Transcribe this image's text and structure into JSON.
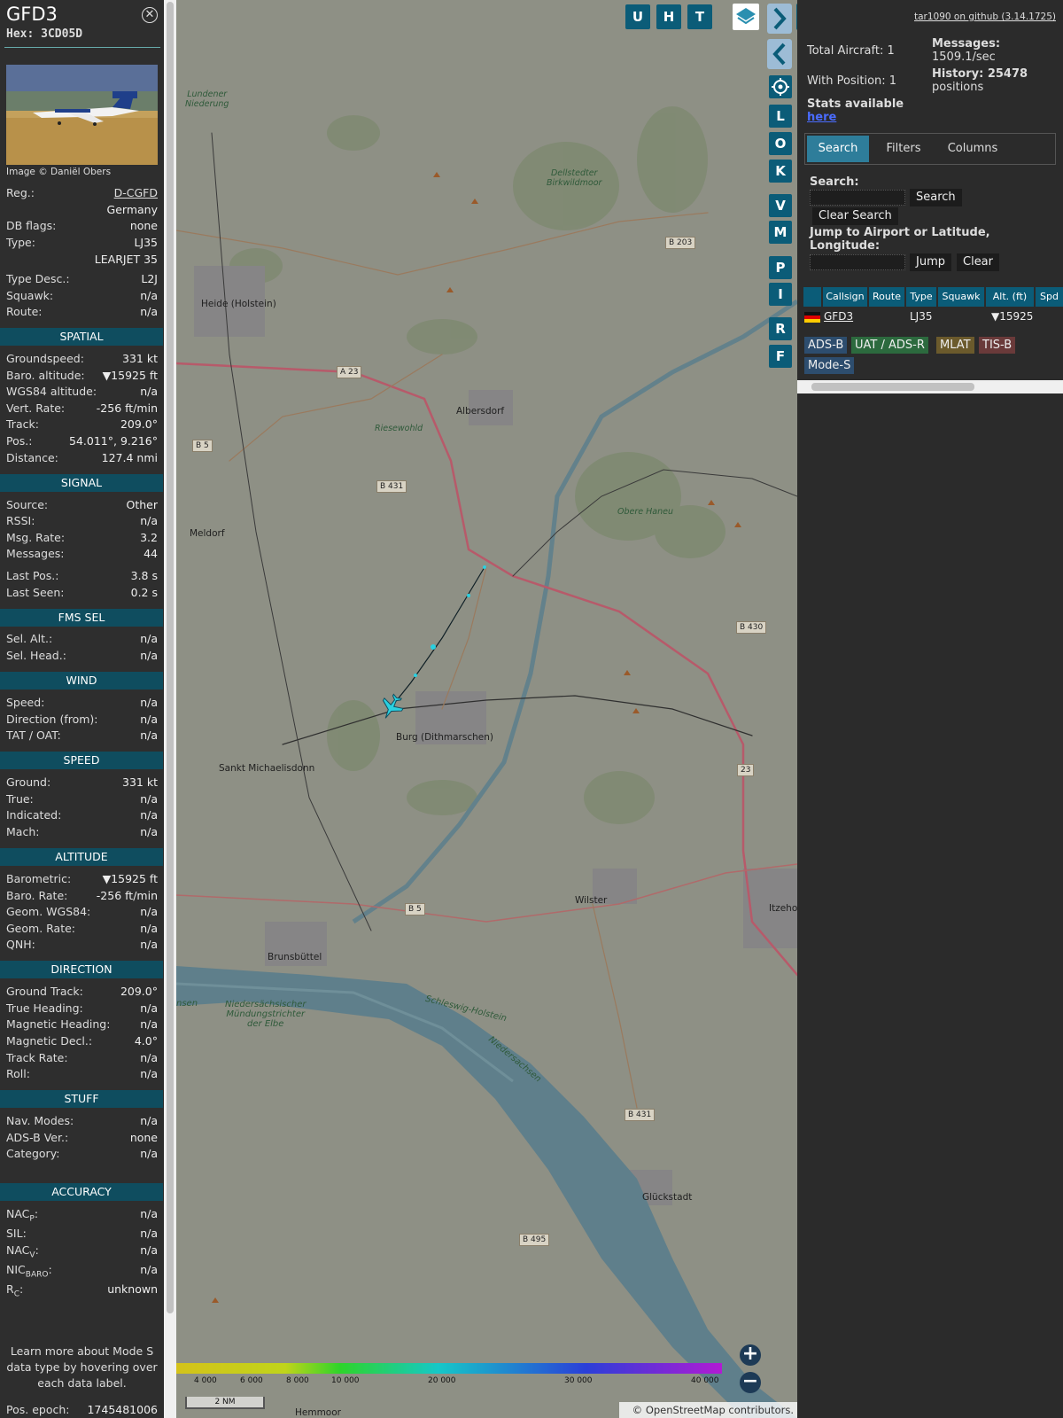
{
  "aircraft": {
    "callsign": "GFD3",
    "hex_label": "Hex: 3CD05D",
    "image_credit": "Image © Daniël Obers",
    "info": [
      {
        "label": "Reg.:",
        "value": "D-CGFD"
      },
      {
        "label": "",
        "value": "Germany"
      },
      {
        "label": "DB flags:",
        "value": "none"
      },
      {
        "label": "Type:",
        "value": "LJ35"
      },
      {
        "label": "",
        "value": "LEARJET 35"
      },
      {
        "label": "Type Desc.:",
        "value": "L2J"
      },
      {
        "label": "Squawk:",
        "value": "n/a"
      },
      {
        "label": "Route:",
        "value": "n/a"
      }
    ]
  },
  "sections": {
    "spatial": {
      "title": "SPATIAL",
      "rows": [
        {
          "label": "Groundspeed:",
          "value": "331 kt"
        },
        {
          "label": "Baro. altitude:",
          "value": "▼15925 ft"
        },
        {
          "label": "WGS84 altitude:",
          "value": "n/a"
        },
        {
          "label": "Vert. Rate:",
          "value": "-256 ft/min"
        },
        {
          "label": "Track:",
          "value": "209.0°"
        },
        {
          "label": "Pos.:",
          "value": "54.011°, 9.216°"
        },
        {
          "label": "Distance:",
          "value": "127.4 nmi"
        }
      ]
    },
    "signal": {
      "title": "SIGNAL",
      "rows": [
        {
          "label": "Source:",
          "value": "Other"
        },
        {
          "label": "RSSI:",
          "value": "n/a"
        },
        {
          "label": "Msg. Rate:",
          "value": "3.2"
        },
        {
          "label": "Messages:",
          "value": "44"
        },
        {
          "label": "Last Pos.:",
          "value": "3.8 s"
        },
        {
          "label": "Last Seen:",
          "value": "0.2 s"
        }
      ]
    },
    "fms": {
      "title": "FMS SEL",
      "rows": [
        {
          "label": "Sel. Alt.:",
          "value": "n/a"
        },
        {
          "label": "Sel. Head.:",
          "value": "n/a"
        }
      ]
    },
    "wind": {
      "title": "WIND",
      "rows": [
        {
          "label": "Speed:",
          "value": "n/a"
        },
        {
          "label": "Direction (from):",
          "value": "n/a"
        },
        {
          "label": "TAT / OAT:",
          "value": "n/a"
        }
      ]
    },
    "speed": {
      "title": "SPEED",
      "rows": [
        {
          "label": "Ground:",
          "value": "331 kt"
        },
        {
          "label": "True:",
          "value": "n/a"
        },
        {
          "label": "Indicated:",
          "value": "n/a"
        },
        {
          "label": "Mach:",
          "value": "n/a"
        }
      ]
    },
    "altitude": {
      "title": "ALTITUDE",
      "rows": [
        {
          "label": "Barometric:",
          "value": "▼15925 ft"
        },
        {
          "label": "Baro. Rate:",
          "value": "-256 ft/min"
        },
        {
          "label": "Geom. WGS84:",
          "value": "n/a"
        },
        {
          "label": "Geom. Rate:",
          "value": "n/a"
        },
        {
          "label": "QNH:",
          "value": "n/a"
        }
      ]
    },
    "direction": {
      "title": "DIRECTION",
      "rows": [
        {
          "label": "Ground Track:",
          "value": "209.0°"
        },
        {
          "label": "True Heading:",
          "value": "n/a"
        },
        {
          "label": "Magnetic Heading:",
          "value": "n/a"
        },
        {
          "label": "Magnetic Decl.:",
          "value": "4.0°"
        },
        {
          "label": "Track Rate:",
          "value": "n/a"
        },
        {
          "label": "Roll:",
          "value": "n/a"
        }
      ]
    },
    "stuff": {
      "title": "STUFF",
      "rows": [
        {
          "label": "Nav. Modes:",
          "value": "n/a"
        },
        {
          "label": "ADS-B Ver.:",
          "value": "none"
        },
        {
          "label": "Category:",
          "value": "n/a"
        }
      ]
    },
    "accuracy": {
      "title": "ACCURACY",
      "rows": [
        {
          "label": "NAC",
          "sub": "P",
          "suffix": ":",
          "value": "n/a"
        },
        {
          "label": "SIL:",
          "sub": "",
          "suffix": "",
          "value": "n/a"
        },
        {
          "label": "NAC",
          "sub": "V",
          "suffix": ":",
          "value": "n/a"
        },
        {
          "label": "NIC",
          "sub": "BARO",
          "suffix": ":",
          "value": "n/a"
        },
        {
          "label": "R",
          "sub": "C",
          "suffix": ":",
          "value": "unknown"
        }
      ]
    }
  },
  "learn_more": "Learn more about Mode S data type by hovering over each data label.",
  "pos_epoch": {
    "label": "Pos. epoch:",
    "value": "1745481006"
  },
  "map": {
    "top_buttons": [
      "U",
      "H",
      "T"
    ],
    "side_buttons": [
      "L",
      "O",
      "K",
      "V",
      "M",
      "P",
      "I",
      "R",
      "F"
    ],
    "places": [
      "Heide (Holstein)",
      "Albersdorf",
      "Meldorf",
      "Burg (Dithmarschen)",
      "Sankt Michaelisdonn",
      "Wilster",
      "Brunsbüttel",
      "Glückstadt",
      "Itzeho",
      "Hemmoor"
    ],
    "nature": [
      "Lundener\nNiederung",
      "Dellstedter\nBirkwildmoor",
      "Riesewohld",
      "Obere Haneu",
      "Niedersächsischer\nMündungstrichter\nder Elbe",
      "Schleswig-Holstein",
      "Niedersachsen",
      "nsen"
    ],
    "roads": [
      "B 203",
      "A 23",
      "B 5",
      "B 431",
      "B 430",
      "B 5",
      "23",
      "B 431",
      "B 495"
    ],
    "legend_ticks": [
      "4 000",
      "6 000",
      "8 000",
      "10 000",
      "20 000",
      "30 000",
      "40 000"
    ],
    "scale": "2 NM",
    "attribution_prefix": "© ",
    "attribution_link": "OpenStreetMap",
    "attribution_suffix": " contributors."
  },
  "right": {
    "github": "tar1090 on github (3.14.1725)",
    "total_aircraft": "Total Aircraft: 1",
    "with_position": "With Position: 1",
    "messages_label": "Messages:",
    "messages_value": "1509.1/sec",
    "history_label": "History: 25478",
    "history_value": "positions",
    "stats_label": "Stats available",
    "stats_link": "here",
    "tabs": [
      "Search",
      "Filters",
      "Columns"
    ],
    "search_label": "Search:",
    "search_button": "Search",
    "clear_search": "Clear Search",
    "jump_label": "Jump to Airport or Latitude,",
    "jump_label2": "Longitude:",
    "jump_button": "Jump",
    "clear_button": "Clear",
    "table_headers": [
      "Callsign",
      "Route",
      "Type",
      "Squawk",
      "Alt. (ft)",
      "Spd"
    ],
    "table_row": {
      "callsign": "GFD3",
      "route": "",
      "type": "LJ35",
      "squawk": "",
      "alt": "▼15925"
    },
    "badges": [
      "ADS-B",
      "UAT / ADS-R",
      "MLAT",
      "TIS-B",
      "Mode-S"
    ]
  }
}
